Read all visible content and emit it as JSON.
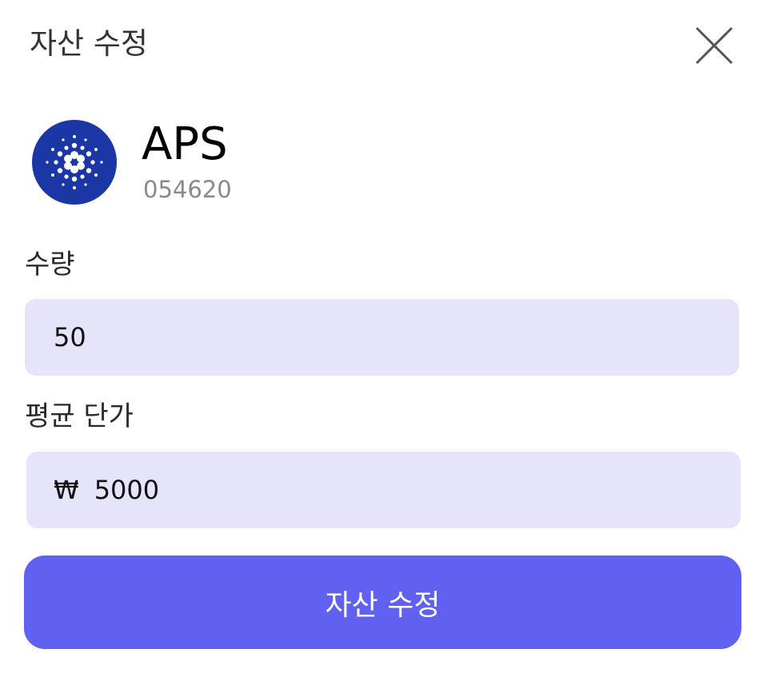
{
  "dialog": {
    "title": "자산 수정",
    "close_icon": "close-icon"
  },
  "asset": {
    "logo_icon": "cardano-logo-icon",
    "logo_color": "#1b37a6",
    "name": "APS",
    "code": "054620"
  },
  "quantity": {
    "label": "수량",
    "value": "50"
  },
  "avg_price": {
    "label": "평균 단가",
    "currency_symbol": "₩",
    "value": "5000"
  },
  "submit": {
    "label": "자산 수정",
    "color": "#6060f1"
  },
  "colors": {
    "input_background": "#e6e4fb"
  }
}
